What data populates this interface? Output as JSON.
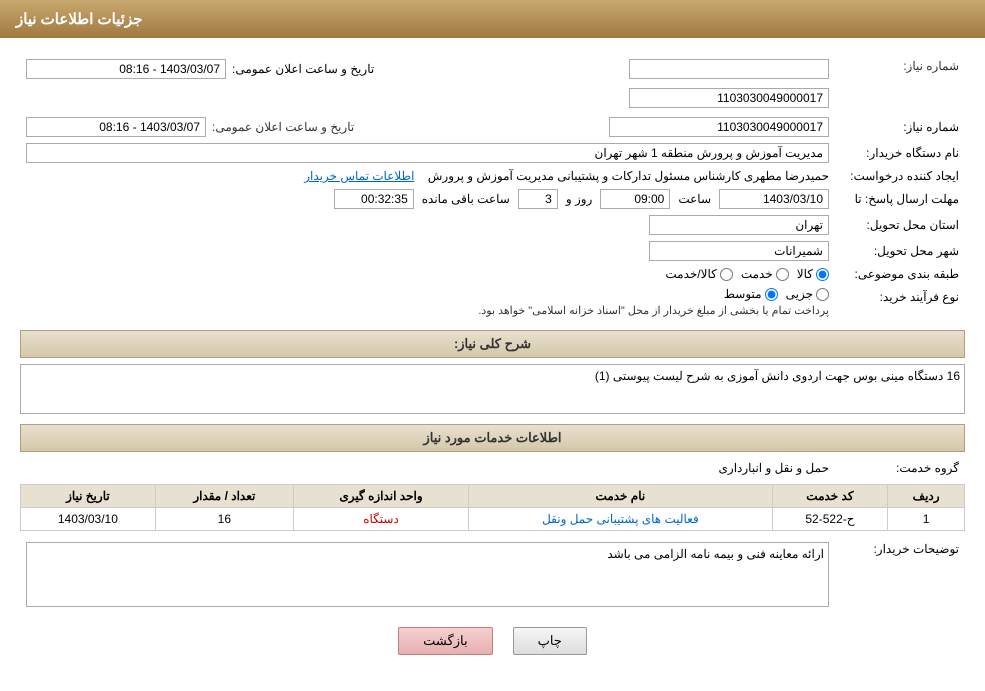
{
  "header": {
    "title": "جزئیات اطلاعات نیاز"
  },
  "fields": {
    "need_number_label": "شماره نیاز:",
    "need_number_value": "1103030049000017",
    "announcement_date_label": "تاریخ و ساعت اعلان عمومی:",
    "announcement_date_value": "1403/03/07 - 08:16",
    "buyer_name_label": "نام دستگاه خریدار:",
    "buyer_name_value": "مدیریت آموزش و پرورش منطقه 1 شهر تهران",
    "creator_label": "ایجاد کننده درخواست:",
    "creator_value": "حمیدرضا مطهری کارشناس مسئول تدارکات و پشتیبانی مدیریت آموزش و پرورش",
    "contact_link": "اطلاعات تماس خریدار",
    "deadline_label": "مهلت ارسال پاسخ: تا",
    "deadline_date": "1403/03/10",
    "deadline_time_label": "ساعت",
    "deadline_time": "09:00",
    "deadline_days_label": "روز و",
    "deadline_days": "3",
    "remaining_label": "ساعت باقی مانده",
    "remaining_time": "00:32:35",
    "province_label": "استان محل تحویل:",
    "province_value": "تهران",
    "city_label": "شهر محل تحویل:",
    "city_value": "شمیرانات",
    "category_label": "طبقه بندی موضوعی:",
    "category_options": [
      "کالا",
      "خدمت",
      "کالا/خدمت"
    ],
    "category_selected": "کالا",
    "purchase_type_label": "نوع فرآیند خرید:",
    "purchase_type_options": [
      "جزیی",
      "متوسط"
    ],
    "purchase_type_note": "پرداخت تمام یا بخشی از مبلغ خریدار از محل \"اسناد خزانه اسلامی\" خواهد بود.",
    "description_section_title": "شرح کلی نیاز:",
    "description_value": "16 دستگاه مینی بوس جهت اردوی دانش آموزی به شرح لیست پیوستی (1)",
    "services_section_title": "اطلاعات خدمات مورد نیاز",
    "service_group_label": "گروه خدمت:",
    "service_group_value": "حمل و نقل و انبارداری",
    "table": {
      "columns": [
        "ردیف",
        "کد خدمت",
        "نام خدمت",
        "واحد اندازه گیری",
        "تعداد / مقدار",
        "تاریخ نیاز"
      ],
      "rows": [
        {
          "row": "1",
          "code": "ح-522-52",
          "name": "فعالیت های پشتیبانی حمل ونقل",
          "unit": "دستگاه",
          "quantity": "16",
          "date": "1403/03/10"
        }
      ]
    },
    "buyer_desc_label": "توضیحات خریدار:",
    "buyer_desc_value": "ارائه معاینه فنی و بیمه نامه الزامی می باشد"
  },
  "buttons": {
    "print_label": "چاپ",
    "back_label": "بازگشت"
  }
}
